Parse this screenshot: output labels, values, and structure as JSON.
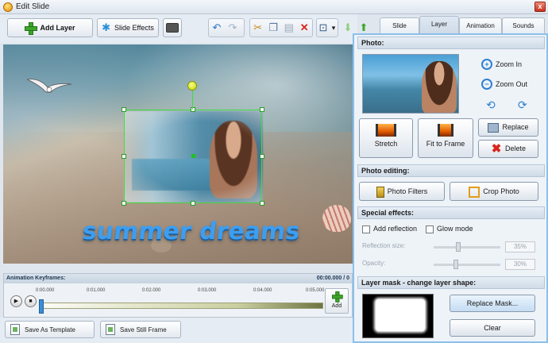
{
  "window": {
    "title": "Edit Slide",
    "close_glyph": "x"
  },
  "toolbar": {
    "add_layer": "Add Layer",
    "slide_effects": "Slide Effects",
    "undo": "↶",
    "redo": "↷",
    "cut": "✂",
    "copy": "❐",
    "paste": "▤",
    "delete": "✕",
    "grid": "⊡",
    "grid_arrow": "▾",
    "move_down": "⬇",
    "move_up": "⬆"
  },
  "tabs": [
    {
      "label": "Slide"
    },
    {
      "label": "Layer"
    },
    {
      "label": "Animation"
    },
    {
      "label": "Sounds"
    }
  ],
  "canvas": {
    "text_layer": "summer dreams"
  },
  "timeline": {
    "header": "Animation Keyframes:",
    "time": "00:00.000 / 0",
    "ticks": [
      "0:00.000",
      "0:01.000",
      "0:02.000",
      "0:03.000",
      "0:04.000",
      "0:05.000"
    ],
    "play": "▶",
    "stop": "■",
    "add_label": "Add"
  },
  "bottom": {
    "save_template": "Save As Template",
    "save_still": "Save Still Frame"
  },
  "panel": {
    "photo_header": "Photo:",
    "zoom_in": "Zoom In",
    "zoom_out": "Zoom Out",
    "zoom_in_glyph": "+",
    "zoom_out_glyph": "−",
    "rotate_left_glyph": "⟲",
    "rotate_right_glyph": "⟳",
    "stretch": "Stretch",
    "fit_to_frame": "Fit to Frame",
    "replace": "Replace",
    "delete": "Delete",
    "delete_glyph": "✖",
    "editing_header": "Photo editing:",
    "photo_filters": "Photo Filters",
    "crop_photo": "Crop Photo",
    "effects_header": "Special effects:",
    "add_reflection": "Add reflection",
    "glow_mode": "Glow mode",
    "reflection_size_label": "Reflection size:",
    "reflection_size_value": "35%",
    "reflection_size": 35,
    "opacity_label": "Opacity:",
    "opacity_value": "30%",
    "opacity": 30,
    "mask_header": "Layer mask - change layer shape:",
    "replace_mask": "Replace Mask...",
    "clear": "Clear"
  },
  "colors": {
    "accent": "#8ac0ec",
    "selection": "#3fdc3f",
    "text_layer": "#3d9ef0"
  }
}
